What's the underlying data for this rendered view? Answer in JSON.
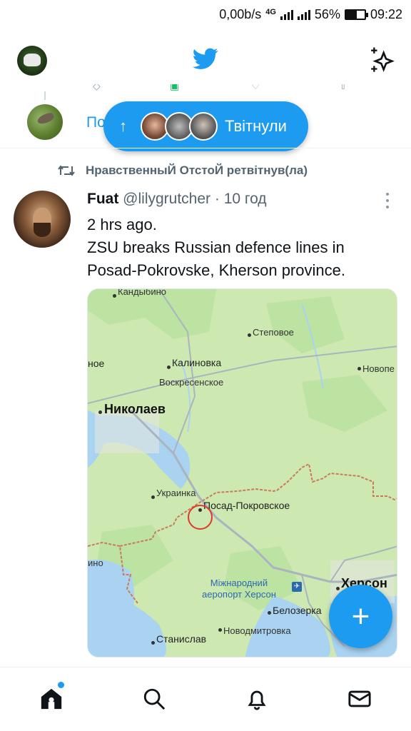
{
  "status_bar": {
    "speed": "0,00b/s",
    "network": "4G",
    "battery_percent": "56%",
    "battery_level": 0.56,
    "time": "09:22"
  },
  "header": {
    "logo_icon": "twitter-bird-icon",
    "sparkle_icon": "sparkle-icon"
  },
  "previous_tweet": {
    "text_fragment": "По"
  },
  "new_tweets_pill": {
    "label": "Твітнули"
  },
  "retweet_context": {
    "text": "НравственныЙ ОтстоЙ ретвітнув(ла)"
  },
  "tweet": {
    "display_name": "Fuat",
    "handle": "@lilygrutcher",
    "time_ago": "· 10 год",
    "lines": [
      "2 hrs ago.",
      "ZSU breaks Russian defence lines in",
      "Posad-Pokrovske, Kherson province."
    ]
  },
  "map": {
    "labels": {
      "kandybino": "Кандыбино",
      "stepovoe": "Степовое",
      "noe": "ное",
      "kalinovka": "Калиновка",
      "novope": "Новопе",
      "voskresenskoe": "Воскресенское",
      "nikolaev": "Николаев",
      "ukrainka": "Украинка",
      "posad": "Посад-Покровское",
      "ino": "ино",
      "airport_line1": "Міжнародний",
      "airport_line2": "аеропорт Херсон",
      "kherson": "Херсон",
      "belozerka": "Белозерка",
      "novodmitrovka": "Новодмитровка",
      "stanislav": "Станислав"
    },
    "colors": {
      "land": "#cde9b1",
      "forest": "#b5e09a",
      "water": "#a9d3f0",
      "road": "#a9b4bf",
      "frontline": "#c97b5c",
      "marker": "#e0382b"
    }
  },
  "fab": {
    "label": "+"
  },
  "nav": {
    "items": [
      "home-icon",
      "search-icon",
      "bell-icon",
      "mail-icon"
    ]
  }
}
